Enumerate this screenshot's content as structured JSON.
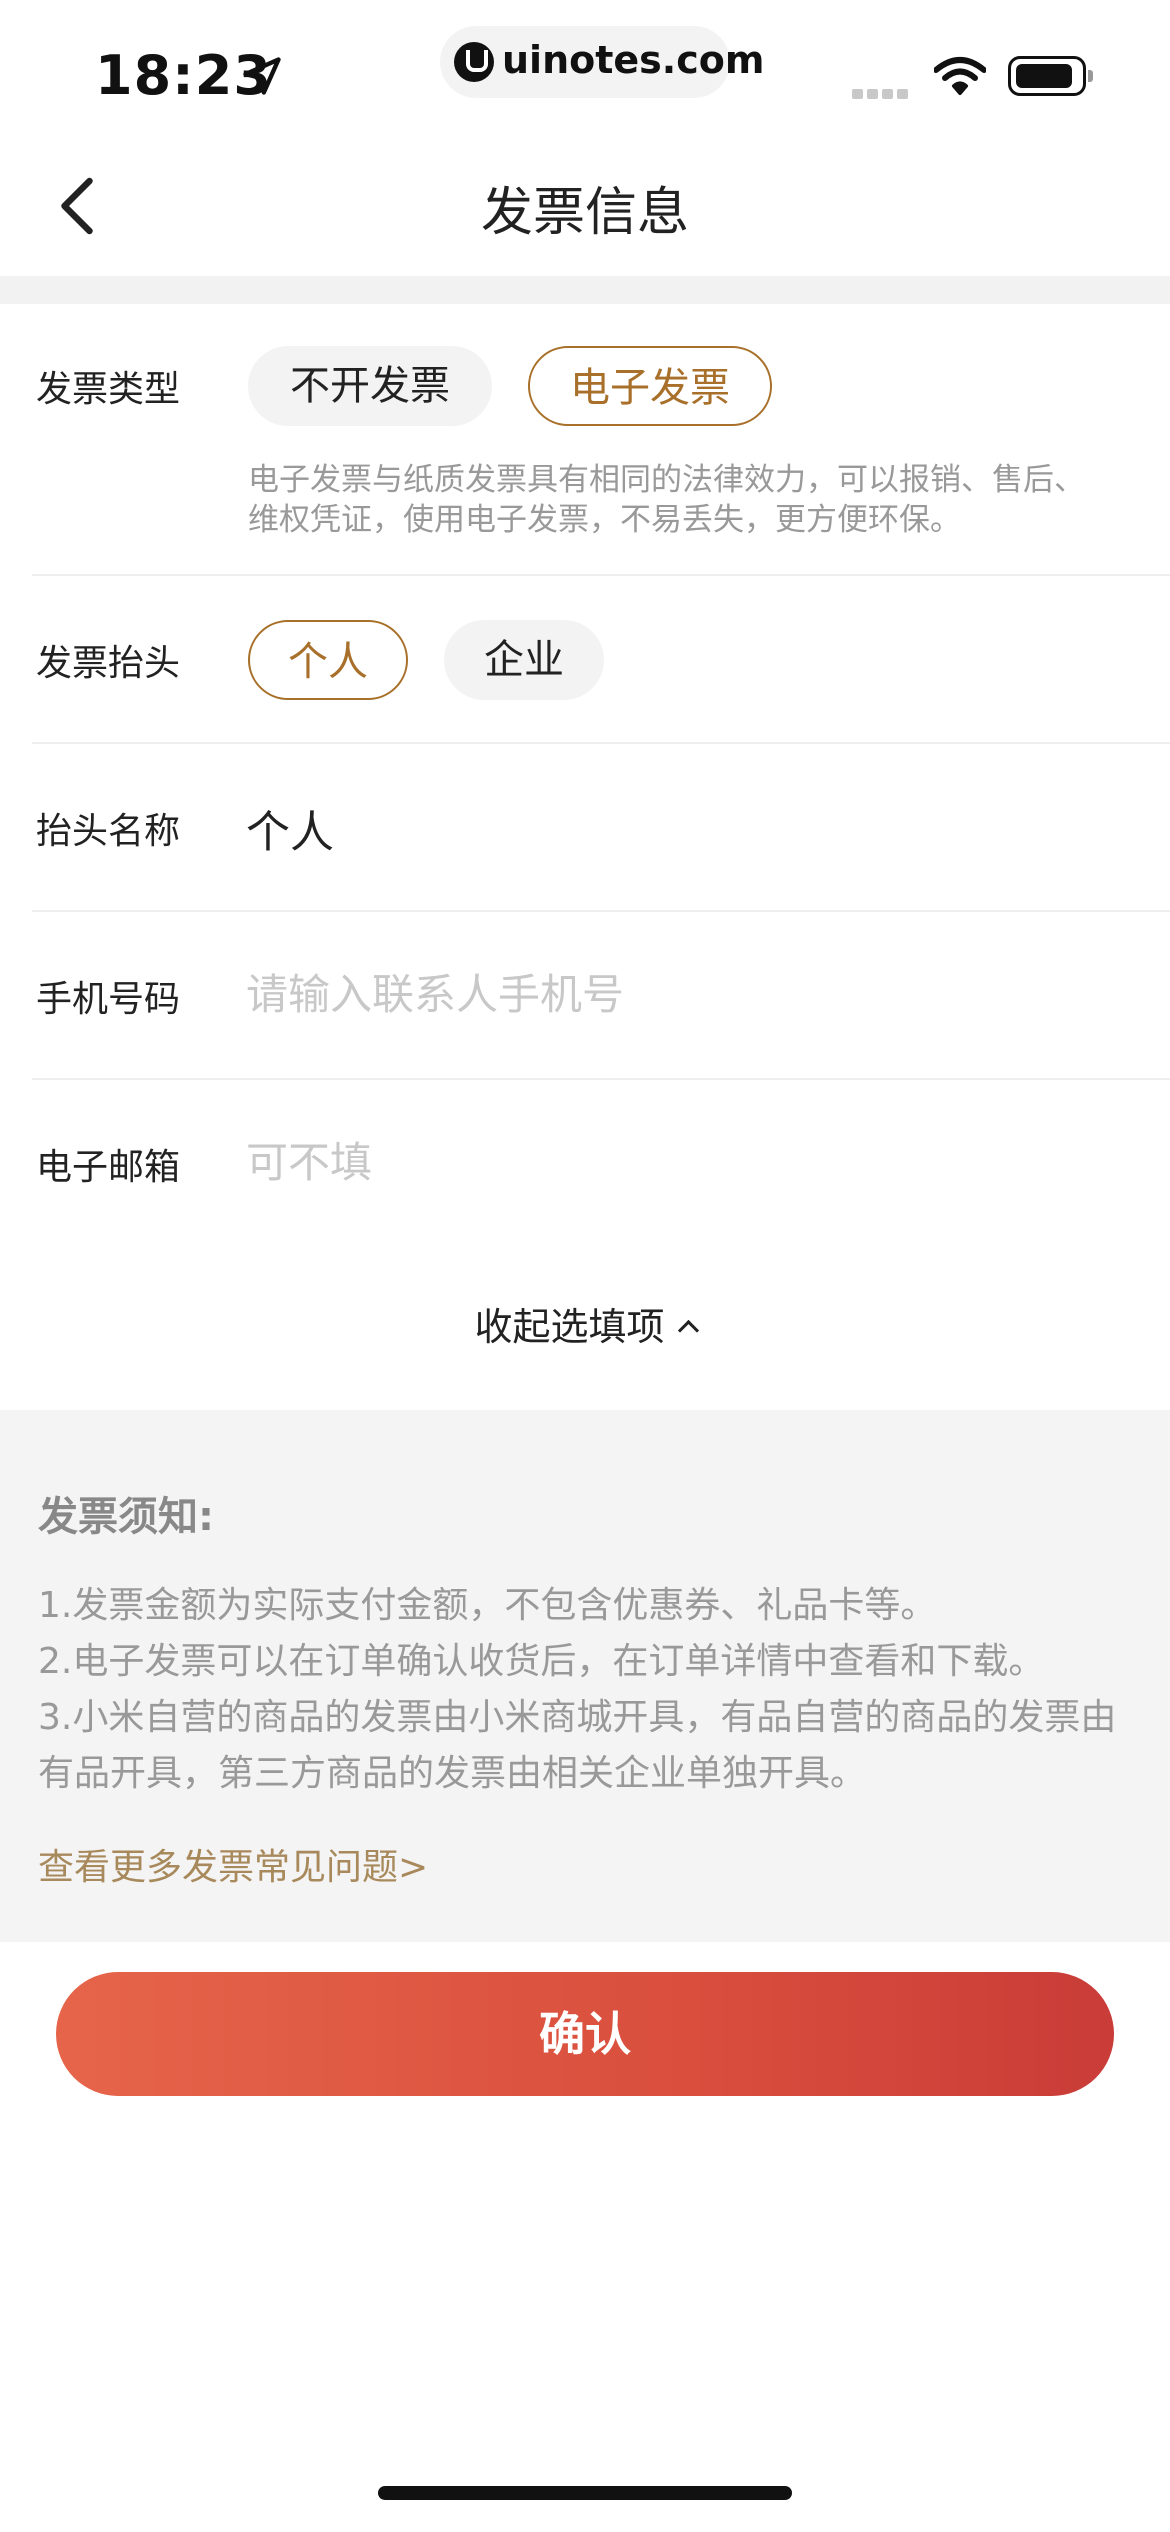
{
  "status_bar": {
    "time": "18:23",
    "url": "uinotes.com",
    "icons": [
      "location-arrow-icon",
      "cellular-signal-icon",
      "wifi-icon",
      "battery-icon"
    ]
  },
  "nav": {
    "title": "发票信息",
    "back_icon": "chevron-left-icon"
  },
  "form": {
    "invoice_type": {
      "label": "发票类型",
      "options": [
        "不开发票",
        "电子发票"
      ],
      "selected": "电子发票",
      "hint": "电子发票与纸质发票具有相同的法律效力，可以报销、售后、维权凭证，使用电子发票，不易丢失，更方便环保。"
    },
    "invoice_header": {
      "label": "发票抬头",
      "options": [
        "个人",
        "企业"
      ],
      "selected": "个人"
    },
    "header_name": {
      "label": "抬头名称",
      "value": "个人"
    },
    "phone": {
      "label": "手机号码",
      "placeholder": "请输入联系人手机号",
      "value": ""
    },
    "email": {
      "label": "电子邮箱",
      "placeholder": "可不填",
      "value": ""
    },
    "collapse_label": "收起选填项"
  },
  "notice": {
    "title": "发票须知:",
    "items": [
      "1.发票金额为实际支付金额，不包含优惠券、礼品卡等。",
      "2.电子发票可以在订单确认收货后，在订单详情中查看和下载。",
      "3.小米自营的商品的发票由小米商城开具，有品自营的商品的发票由有品开具，第三方商品的发票由相关企业单独开具。"
    ],
    "link": "查看更多发票常见问题>"
  },
  "confirm_label": "确认",
  "colors": {
    "accent": "#a8702a",
    "confirm_start": "#e6654a",
    "confirm_end": "#c93c38",
    "notice_bg": "#f4f4f4",
    "link": "#a8895c"
  }
}
